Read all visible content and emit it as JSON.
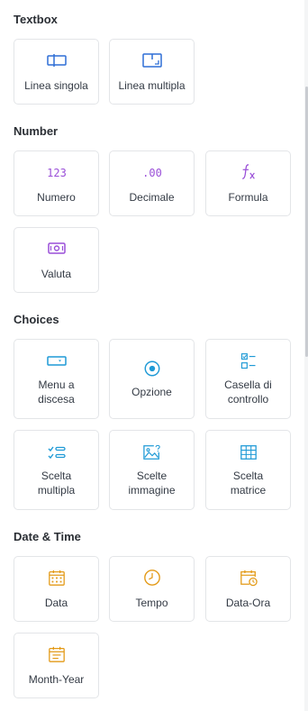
{
  "sections": [
    {
      "title": "Textbox",
      "items": [
        {
          "label": "Linea singola",
          "icon": "single-line-icon"
        },
        {
          "label": "Linea multipla",
          "icon": "multi-line-icon"
        }
      ]
    },
    {
      "title": "Number",
      "items": [
        {
          "label": "Numero",
          "icon": "number-icon",
          "glyph": "123"
        },
        {
          "label": "Decimale",
          "icon": "decimal-icon",
          "glyph": ".00"
        },
        {
          "label": "Formula",
          "icon": "formula-icon",
          "glyph": "fx"
        },
        {
          "label": "Valuta",
          "icon": "currency-icon"
        }
      ]
    },
    {
      "title": "Choices",
      "items": [
        {
          "label": "Menu a discesa",
          "icon": "dropdown-icon"
        },
        {
          "label": "Opzione",
          "icon": "radio-icon"
        },
        {
          "label": "Casella di controllo",
          "icon": "checkbox-icon"
        },
        {
          "label": "Scelta multipla",
          "icon": "multiple-choice-icon"
        },
        {
          "label": "Scelte immagine",
          "icon": "image-choice-icon"
        },
        {
          "label": "Scelta matrice",
          "icon": "matrix-icon"
        }
      ]
    },
    {
      "title": "Date & Time",
      "items": [
        {
          "label": "Data",
          "icon": "calendar-icon"
        },
        {
          "label": "Tempo",
          "icon": "clock-icon"
        },
        {
          "label": "Data-Ora",
          "icon": "datetime-icon"
        },
        {
          "label": "Month-Year",
          "icon": "month-year-icon"
        }
      ]
    }
  ],
  "colors": {
    "textbox": "#2f6fd6",
    "number": "#9a4fd8",
    "choices": "#1f9ad6",
    "datetime": "#e39a17"
  }
}
